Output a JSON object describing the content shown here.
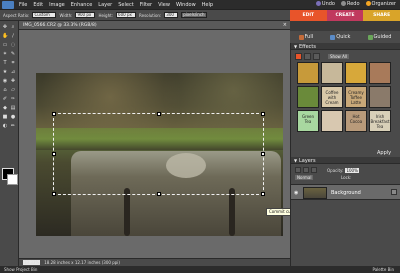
{
  "menu": [
    "File",
    "Edit",
    "Image",
    "Enhance",
    "Layer",
    "Select",
    "Filter",
    "View",
    "Window",
    "Help"
  ],
  "topright": {
    "undo": "Undo",
    "redo": "Redo",
    "organizer": "Organizer"
  },
  "options": {
    "aspect_label": "Aspect Ratio:",
    "aspect_value": "Custom",
    "width_label": "Width:",
    "width_value": "900 px",
    "height_label": "Height:",
    "height_value": "600 px",
    "resolution_label": "Resolution:",
    "resolution_value": "300",
    "res_unit": "pixels/inch"
  },
  "mode_tabs": {
    "edit": "EDIT",
    "create": "CREATE",
    "share": "SHARE"
  },
  "sub_tabs": {
    "full": "Full",
    "quick": "Quick",
    "guided": "Guided"
  },
  "document": {
    "title": "IMG_0566.CR2 @ 33.3% (RGB/8)",
    "close": "×"
  },
  "tooltip": "Commit current operation",
  "status": {
    "zoom": "33.33%",
    "info": "18.28 inches x 12.17 inches (300 ppi)"
  },
  "bottom": {
    "project_bin": "Show Project Bin",
    "right_items": [
      "Palette Bin"
    ]
  },
  "effects": {
    "title": "Effects",
    "show_all": "Show All",
    "apply": "Apply",
    "thumbs": [
      {
        "label": "",
        "color": "#c79a3a"
      },
      {
        "label": "",
        "color": "#c7b89a"
      },
      {
        "label": "",
        "color": "#d7a83a"
      },
      {
        "label": "",
        "color": "#a87a5a"
      },
      {
        "label": "",
        "color": "#6a8a3a"
      },
      {
        "label": "Coffee with Cream",
        "color": "#d8c8a8"
      },
      {
        "label": "Creamy Toffee Latte",
        "color": "#c8a878"
      },
      {
        "label": "",
        "color": "#8a7a6a"
      },
      {
        "label": "Green Tea",
        "color": "#a8d8a0"
      },
      {
        "label": "",
        "color": "#d8c8b0"
      },
      {
        "label": "Hot Cocoa",
        "color": "#b89a7a"
      },
      {
        "label": "Irish Breakfast Tea",
        "color": "#d8d0b8"
      }
    ]
  },
  "layers": {
    "title": "Layers",
    "blend_mode": "Normal",
    "opacity_label": "Opacity:",
    "opacity_value": "100%",
    "lock_label": "Lock:",
    "layer_name": "Background"
  }
}
